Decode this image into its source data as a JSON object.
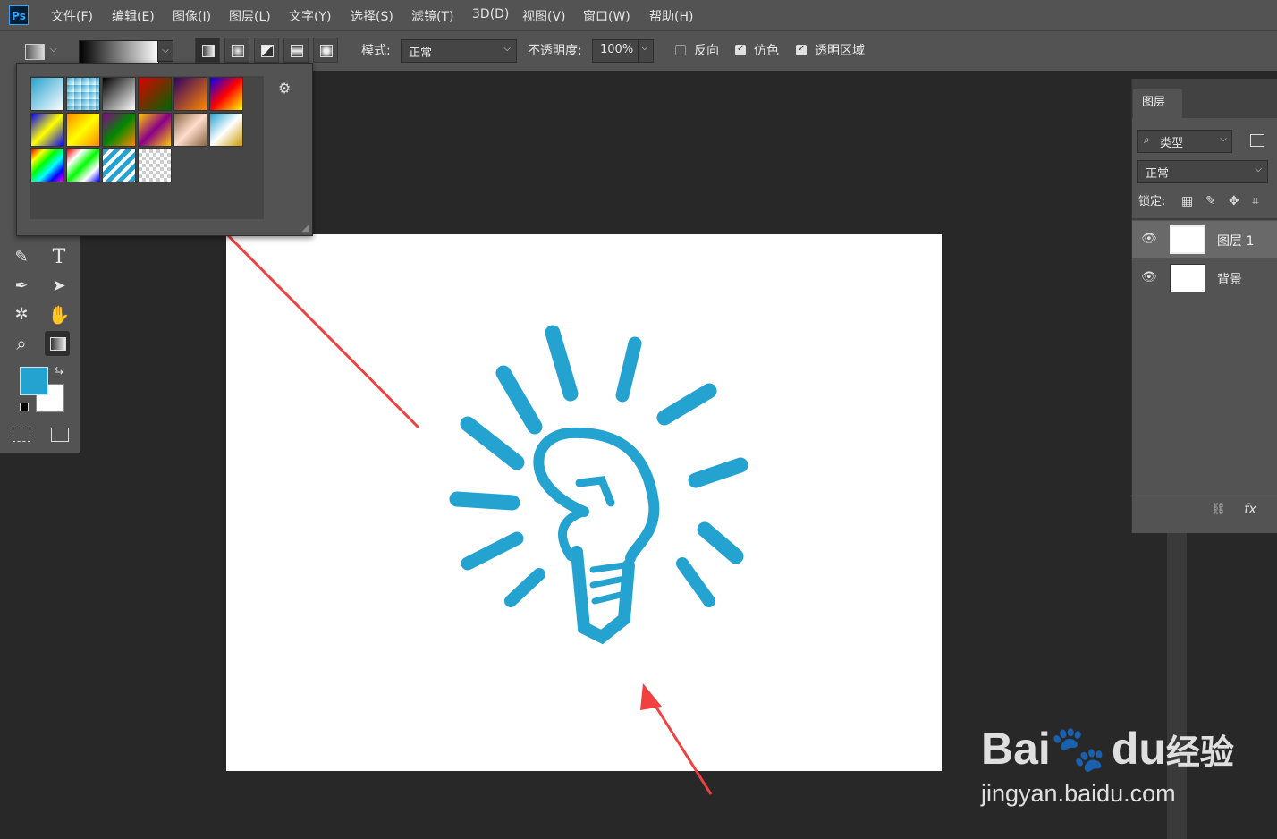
{
  "app": {
    "logo": "Ps"
  },
  "menu": [
    "文件(F)",
    "编辑(E)",
    "图像(I)",
    "图层(L)",
    "文字(Y)",
    "选择(S)",
    "滤镜(T)",
    "3D(D)",
    "视图(V)",
    "窗口(W)",
    "帮助(H)"
  ],
  "options": {
    "mode_label": "模式:",
    "mode_value": "正常",
    "opacity_label": "不透明度:",
    "opacity_value": "100%",
    "reverse_label": "反向",
    "reverse_checked": false,
    "dither_label": "仿色",
    "dither_checked": true,
    "transparency_label": "透明区域",
    "transparency_checked": true
  },
  "colors": {
    "foreground": "#25a3d0",
    "background": "#ffffff",
    "arrow": "#f04040",
    "panel": "#535353"
  },
  "layers_panel": {
    "tab": "图层",
    "filter_label": "类型",
    "blend_mode": "正常",
    "lock_label": "锁定:",
    "layers": [
      {
        "name": "图层 1",
        "selected": true
      },
      {
        "name": "背景",
        "selected": false
      }
    ],
    "fx_label": "fx"
  },
  "toolbar": {
    "text_tool_glyph": "T"
  },
  "watermark": {
    "brand": "Bai",
    "brand2": "du",
    "suffix": "经验",
    "url": "jingyan.baidu.com"
  }
}
